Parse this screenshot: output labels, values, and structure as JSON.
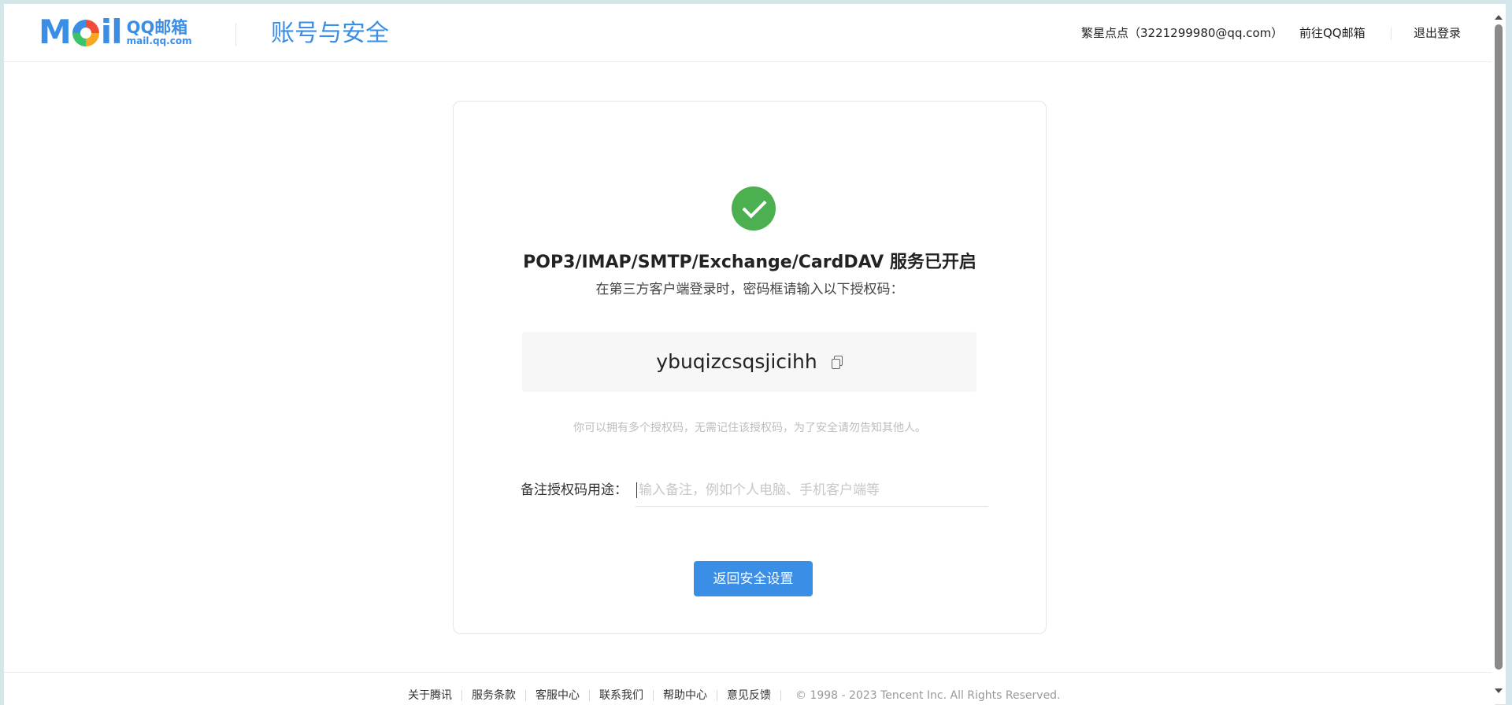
{
  "header": {
    "logo_mail_text": "Mail",
    "logo_cn": "QQ邮箱",
    "logo_domain": "mail.qq.com",
    "page_title": "账号与安全",
    "user_info": "繁星点点（3221299980@qq.com）",
    "go_mail_label": "前往QQ邮箱",
    "logout_label": "退出登录"
  },
  "card": {
    "status_icon": "check-circle-icon",
    "status_title": "POP3/IMAP/SMTP/Exchange/CardDAV 服务已开启",
    "status_sub": "在第三方客户端登录时，密码框请输入以下授权码：",
    "auth_code": "ybuqizcsqsjicihh",
    "copy_icon": "copy-icon",
    "hint": "你可以拥有多个授权码，无需记住该授权码，为了安全请勿告知其他人。",
    "note_label": "备注授权码用途：",
    "note_placeholder": "输入备注，例如个人电脑、手机客户端等",
    "note_value": "",
    "back_button_label": "返回安全设置"
  },
  "footer": {
    "links": [
      "关于腾讯",
      "服务条款",
      "客服中心",
      "联系我们",
      "帮助中心",
      "意见反馈"
    ],
    "copyright": "© 1998 - 2023 Tencent Inc. All Rights Reserved."
  },
  "colors": {
    "accent": "#3a8ee6",
    "success": "#4caf50",
    "page_bg": "#d5e6ea"
  }
}
